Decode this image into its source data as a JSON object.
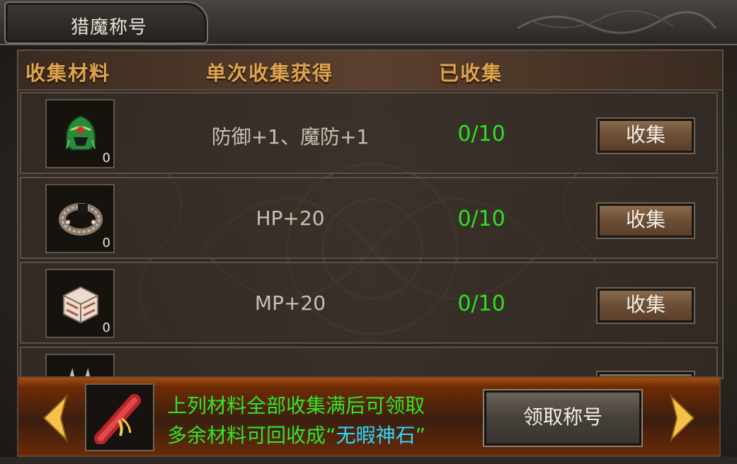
{
  "window": {
    "title": "猎魔称号"
  },
  "table": {
    "headers": {
      "material": "收集材料",
      "reward": "单次收集获得",
      "collected": "已收集"
    },
    "rows": [
      {
        "item_icon": "helmet-icon",
        "count": "0",
        "bonus": "防御+1、魔防+1",
        "progress": "0/10",
        "button": "收集"
      },
      {
        "item_icon": "bracelet-icon",
        "count": "0",
        "bonus": "HP+20",
        "progress": "0/10",
        "button": "收集"
      },
      {
        "item_icon": "brick-icon",
        "count": "0",
        "bonus": "MP+20",
        "progress": "0/10",
        "button": "收集"
      }
    ]
  },
  "footer": {
    "reward_icon": "scroll-icon",
    "note_line1": "上列材料全部收集满后可领取",
    "note_line2_prefix": "多余材料可回收成“",
    "note_line2_highlight": "无暇神石",
    "note_line2_suffix": "”",
    "claim_button": "领取称号",
    "prev_icon": "arrow-left-icon",
    "next_icon": "arrow-right-icon"
  },
  "colors": {
    "header_gold": "#e0a44c",
    "progress_green": "#2ee024",
    "note_green": "#32e52a",
    "highlight_cyan": "#2ed8ff"
  }
}
